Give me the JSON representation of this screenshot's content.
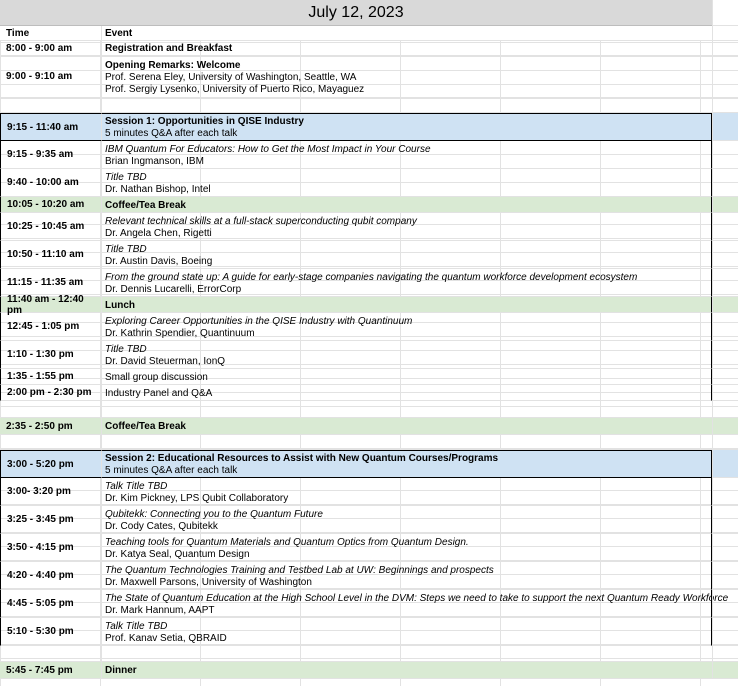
{
  "title": "July 12, 2023",
  "header": {
    "time": "Time",
    "event": "Event"
  },
  "rows": [
    {
      "time": "8:00 - 9:00 am",
      "lines": [
        {
          "t": "Registration and Breakfast",
          "s": "bold"
        }
      ]
    },
    {
      "time": "9:00 - 9:10 am",
      "lines": [
        {
          "t": "Opening Remarks: Welcome",
          "s": "bold"
        },
        {
          "t": "Prof. Serena Eley, University of Washington, Seattle, WA",
          "s": "reg"
        },
        {
          "t": "Prof. Sergiy Lysenko, University of Puerto Rico, Mayaguez",
          "s": "reg"
        }
      ]
    },
    {
      "time": "",
      "lines": []
    },
    {
      "time": "9:15 - 11:40 am",
      "lines": [
        {
          "t": "Session 1: Opportunities in QISE Industry",
          "s": "bold"
        },
        {
          "t": "5 minutes Q&A after each talk",
          "s": "reg"
        }
      ]
    },
    {
      "time": "9:15 - 9:35 am",
      "lines": [
        {
          "t": "IBM Quantum For Educators: How to Get the Most Impact in Your Course",
          "s": "ital"
        },
        {
          "t": "Brian Ingmanson, IBM",
          "s": "reg"
        }
      ]
    },
    {
      "time": "9:40 - 10:00 am",
      "lines": [
        {
          "t": "Title TBD",
          "s": "ital"
        },
        {
          "t": "Dr. Nathan Bishop, Intel",
          "s": "reg"
        }
      ]
    },
    {
      "time": "10:05 - 10:20 am",
      "lines": [
        {
          "t": "Coffee/Tea Break",
          "s": "bold"
        }
      ]
    },
    {
      "time": "10:25 - 10:45 am",
      "lines": [
        {
          "t": "Relevant technical skills at a full-stack superconducting qubit company",
          "s": "ital"
        },
        {
          "t": "Dr. Angela Chen, Rigetti",
          "s": "reg"
        }
      ]
    },
    {
      "time": "10:50 - 11:10 am",
      "lines": [
        {
          "t": "Title TBD",
          "s": "ital"
        },
        {
          "t": "Dr. Austin Davis, Boeing",
          "s": "reg"
        }
      ]
    },
    {
      "time": "11:15 - 11:35 am",
      "lines": [
        {
          "t": "From the ground state up: A guide for early-stage companies navigating the quantum workforce development ecosystem",
          "s": "ital"
        },
        {
          "t": "Dr. Dennis Lucarelli, ErrorCorp",
          "s": "reg"
        }
      ]
    },
    {
      "time": "11:40 am - 12:40 pm",
      "lines": [
        {
          "t": "Lunch",
          "s": "bold"
        }
      ]
    },
    {
      "time": "12:45 - 1:05 pm",
      "lines": [
        {
          "t": "Exploring Career Opportunities in the QISE Industry with Quantinuum",
          "s": "ital"
        },
        {
          "t": "Dr. Kathrin Spendier, Quantinuum",
          "s": "reg"
        }
      ]
    },
    {
      "time": "1:10 - 1:30 pm",
      "lines": [
        {
          "t": "Title TBD",
          "s": "ital"
        },
        {
          "t": "Dr. David Steuerman, IonQ",
          "s": "reg"
        }
      ]
    },
    {
      "time": "1:35 - 1:55 pm",
      "lines": [
        {
          "t": "Small group discussion",
          "s": "reg"
        }
      ]
    },
    {
      "time": "2:00 pm - 2:30 pm",
      "lines": [
        {
          "t": "Industry Panel and Q&A",
          "s": "reg"
        }
      ]
    },
    {
      "time": "",
      "lines": []
    },
    {
      "time": "2:35 - 2:50 pm",
      "lines": [
        {
          "t": "Coffee/Tea Break",
          "s": "bold"
        }
      ]
    },
    {
      "time": "",
      "lines": []
    },
    {
      "time": "3:00 - 5:20 pm",
      "lines": [
        {
          "t": "Session 2: Educational Resources to Assist with New Quantum Courses/Programs",
          "s": "bold"
        },
        {
          "t": "5 minutes Q&A after each talk",
          "s": "reg"
        }
      ]
    },
    {
      "time": "3:00- 3:20 pm",
      "lines": [
        {
          "t": "Talk Title TBD",
          "s": "ital"
        },
        {
          "t": "Dr. Kim Pickney, LPS Qubit Collaboratory",
          "s": "reg"
        }
      ]
    },
    {
      "time": "3:25 - 3:45 pm",
      "lines": [
        {
          "t": "Qubitekk: Connecting you to the Quantum Future",
          "s": "ital"
        },
        {
          "t": "Dr. Cody Cates, Qubitekk",
          "s": "reg"
        }
      ]
    },
    {
      "time": "3:50 - 4:15 pm",
      "lines": [
        {
          "t": "Teaching tools for Quantum Materials and Quantum Optics from Quantum Design.",
          "s": "ital"
        },
        {
          "t": "Dr. Katya Seal, Quantum Design",
          "s": "reg"
        }
      ]
    },
    {
      "time": "4:20 - 4:40 pm",
      "lines": [
        {
          "t": "The Quantum Technologies Training and Testbed Lab at UW: Beginnings and prospects",
          "s": "ital"
        },
        {
          "t": "Dr. Maxwell Parsons, University of Washington",
          "s": "reg"
        }
      ]
    },
    {
      "time": "4:45 - 5:05 pm",
      "lines": [
        {
          "t": "The State of Quantum Education at the High School Level in the DVM: Steps we need to take to support the next Quantum Ready Workforce",
          "s": "ital"
        },
        {
          "t": "Dr. Mark Hannum, AAPT",
          "s": "reg"
        }
      ]
    },
    {
      "time": "5:10 - 5:30 pm",
      "lines": [
        {
          "t": "Talk Title TBD",
          "s": "ital"
        },
        {
          "t": "Prof. Kanav Setia, QBRAID",
          "s": "reg"
        }
      ]
    },
    {
      "time": "",
      "lines": []
    },
    {
      "time": "5:45 - 7:45 pm",
      "lines": [
        {
          "t": "Dinner",
          "s": "bold"
        }
      ]
    }
  ],
  "colors": {
    "session": "#cfe2f3",
    "break": "#d9ead3",
    "title_bg": "#d9d9d9"
  }
}
